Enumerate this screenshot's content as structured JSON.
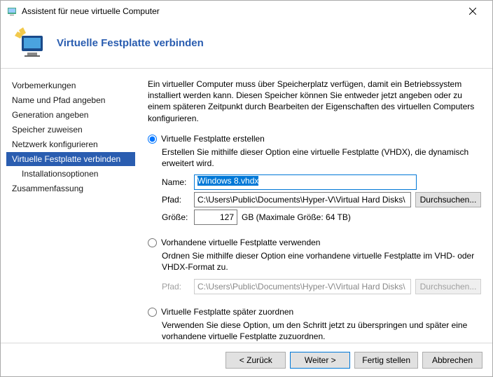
{
  "window_title": "Assistent für neue virtuelle Computer",
  "header_title": "Virtuelle Festplatte verbinden",
  "sidebar": {
    "items": [
      {
        "label": "Vorbemerkungen"
      },
      {
        "label": "Name und Pfad angeben"
      },
      {
        "label": "Generation angeben"
      },
      {
        "label": "Speicher zuweisen"
      },
      {
        "label": "Netzwerk konfigurieren"
      },
      {
        "label": "Virtuelle Festplatte verbinden"
      },
      {
        "label": "Installationsoptionen"
      },
      {
        "label": "Zusammenfassung"
      }
    ],
    "active_index": 5
  },
  "intro": "Ein virtueller Computer muss über Speicherplatz verfügen, damit ein Betriebssystem installiert werden kann. Diesen Speicher können Sie entweder jetzt angeben oder zu einem späteren Zeitpunkt durch Bearbeiten der Eigenschaften des virtuellen Computers konfigurieren.",
  "option1": {
    "label": "Virtuelle Festplatte erstellen",
    "desc": "Erstellen Sie mithilfe dieser Option eine virtuelle Festplatte (VHDX), die dynamisch erweitert wird.",
    "name_label": "Name:",
    "name_value": "Windows 8.vhdx",
    "path_label": "Pfad:",
    "path_value": "C:\\Users\\Public\\Documents\\Hyper-V\\Virtual Hard Disks\\",
    "browse_label": "Durchsuchen...",
    "size_label": "Größe:",
    "size_value": "127",
    "size_hint": "GB (Maximale Größe: 64 TB)"
  },
  "option2": {
    "label": "Vorhandene virtuelle Festplatte verwenden",
    "desc": "Ordnen Sie mithilfe dieser Option eine vorhandene virtuelle Festplatte im VHD- oder VHDX-Format zu.",
    "path_label": "Pfad:",
    "path_value": "C:\\Users\\Public\\Documents\\Hyper-V\\Virtual Hard Disks\\",
    "browse_label": "Durchsuchen..."
  },
  "option3": {
    "label": "Virtuelle Festplatte später zuordnen",
    "desc": "Verwenden Sie diese Option, um den Schritt jetzt zu überspringen und später eine vorhandene virtuelle Festplatte zuzuordnen."
  },
  "footer": {
    "back": "< Zurück",
    "next": "Weiter >",
    "finish": "Fertig stellen",
    "cancel": "Abbrechen"
  }
}
